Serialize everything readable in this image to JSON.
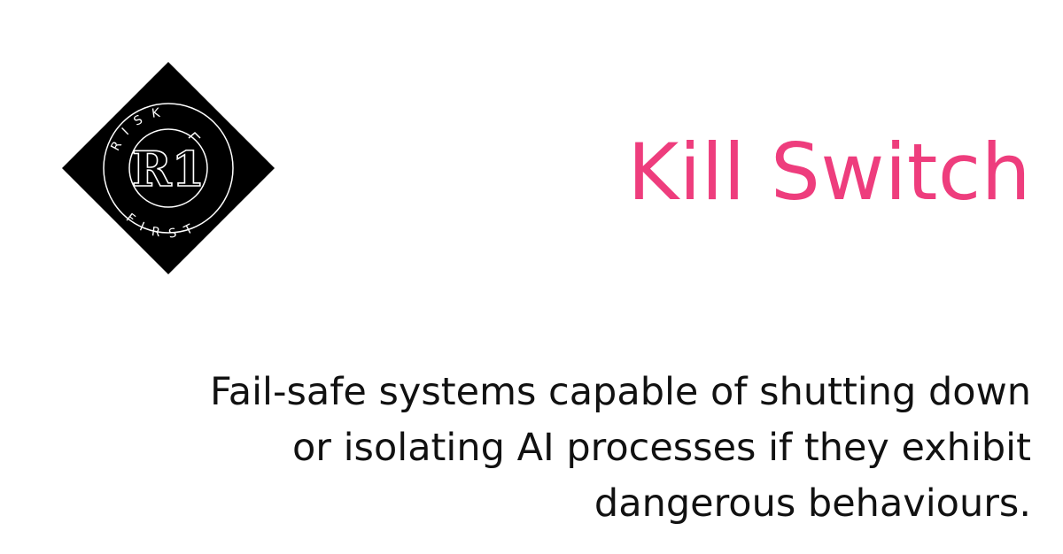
{
  "logo": {
    "monogram": "R1",
    "ring_text_top": "RISK",
    "ring_text_bottom": "FIRST"
  },
  "title": "Kill Switch",
  "description": {
    "lines": [
      "Fail-safe systems capable of shutting down",
      "or isolating AI processes if they exhibit",
      "dangerous behaviours."
    ]
  },
  "colors": {
    "title": "#ee3d7d",
    "text": "#111111",
    "logo_fill": "#000000",
    "logo_line": "#ffffff",
    "background": "#ffffff"
  }
}
